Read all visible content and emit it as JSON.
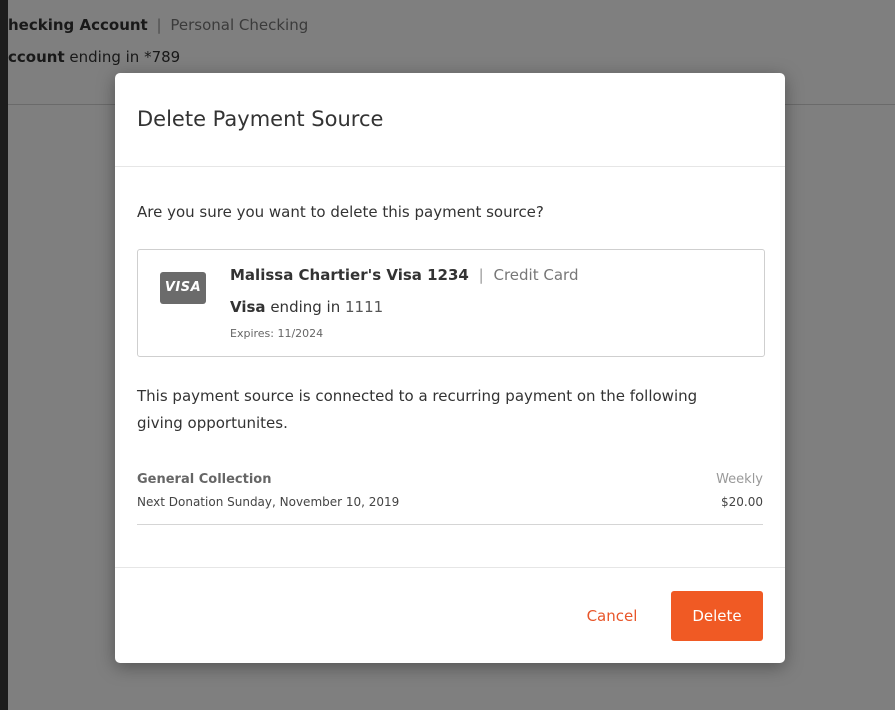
{
  "background": {
    "account_name": "hecking Account",
    "separator": "|",
    "account_type": "Personal Checking",
    "account_label": "ccount",
    "account_suffix": "ending in *789"
  },
  "modal": {
    "title": "Delete Payment Source",
    "confirm_text": "Are you sure you want to delete this payment source?",
    "card": {
      "icon_label": "VISA",
      "name": "Malissa Chartier's Visa 1234",
      "separator": "|",
      "type": "Credit Card",
      "brand": "Visa",
      "ending_text": "ending in",
      "last4": "1111",
      "expires": "Expires: 11/2024"
    },
    "recurring_text": "This payment source is connected to a recurring payment on the following giving opportunites.",
    "opportunity": {
      "name": "General Collection",
      "frequency": "Weekly",
      "next_donation": "Next Donation Sunday, November 10, 2019",
      "amount": "$20.00"
    },
    "footer": {
      "cancel_label": "Cancel",
      "delete_label": "Delete"
    }
  },
  "colors": {
    "accent": "#f05a24",
    "cancel_text": "#e8562a",
    "icon_bg": "#6b6b6b"
  }
}
